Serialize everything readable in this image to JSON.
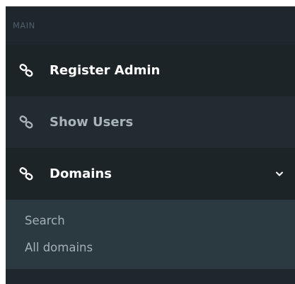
{
  "sidebar": {
    "section_header": "MAIN",
    "items": [
      {
        "label": "Register Admin",
        "icon": "link-icon",
        "state": "active"
      },
      {
        "label": "Show Users",
        "icon": "link-icon",
        "state": "inactive"
      },
      {
        "label": "Domains",
        "icon": "link-icon",
        "state": "expanded",
        "chevron": "chevron-down-icon"
      }
    ],
    "submenu": [
      {
        "label": "Search"
      },
      {
        "label": "All domains"
      }
    ]
  },
  "colors": {
    "sidebar_bg": "#1f272d",
    "submenu_bg": "#2b3a41",
    "active_text": "#ffffff",
    "inactive_text": "#a8b3bb",
    "section_header_text": "#4e5d68"
  }
}
